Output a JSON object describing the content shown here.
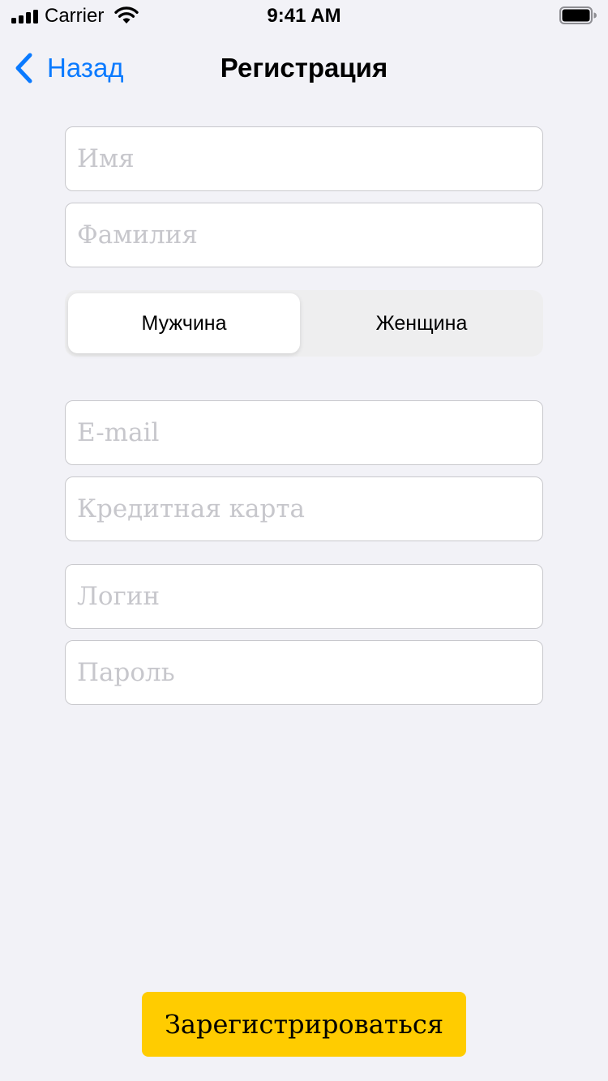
{
  "status_bar": {
    "carrier": "Carrier",
    "time": "9:41 AM",
    "icons": [
      "signal-icon",
      "wifi-icon",
      "battery-icon"
    ]
  },
  "nav": {
    "back_label": "Назад",
    "back_icon": "chevron-left-icon",
    "title": "Регистрация",
    "accent_color": "#0a7aff"
  },
  "form": {
    "first_name": {
      "placeholder": "Имя",
      "value": ""
    },
    "last_name": {
      "placeholder": "Фамилия",
      "value": ""
    },
    "gender": {
      "options": [
        "Мужчина",
        "Женщина"
      ],
      "selected": "Мужчина"
    },
    "email": {
      "placeholder": "E-mail",
      "value": ""
    },
    "credit_card": {
      "placeholder": "Кредитная карта",
      "value": ""
    },
    "login": {
      "placeholder": "Логин",
      "value": ""
    },
    "password": {
      "placeholder": "Пароль",
      "value": ""
    }
  },
  "register_button": {
    "label": "Зарегистрироваться",
    "color": "#ffcc00"
  }
}
